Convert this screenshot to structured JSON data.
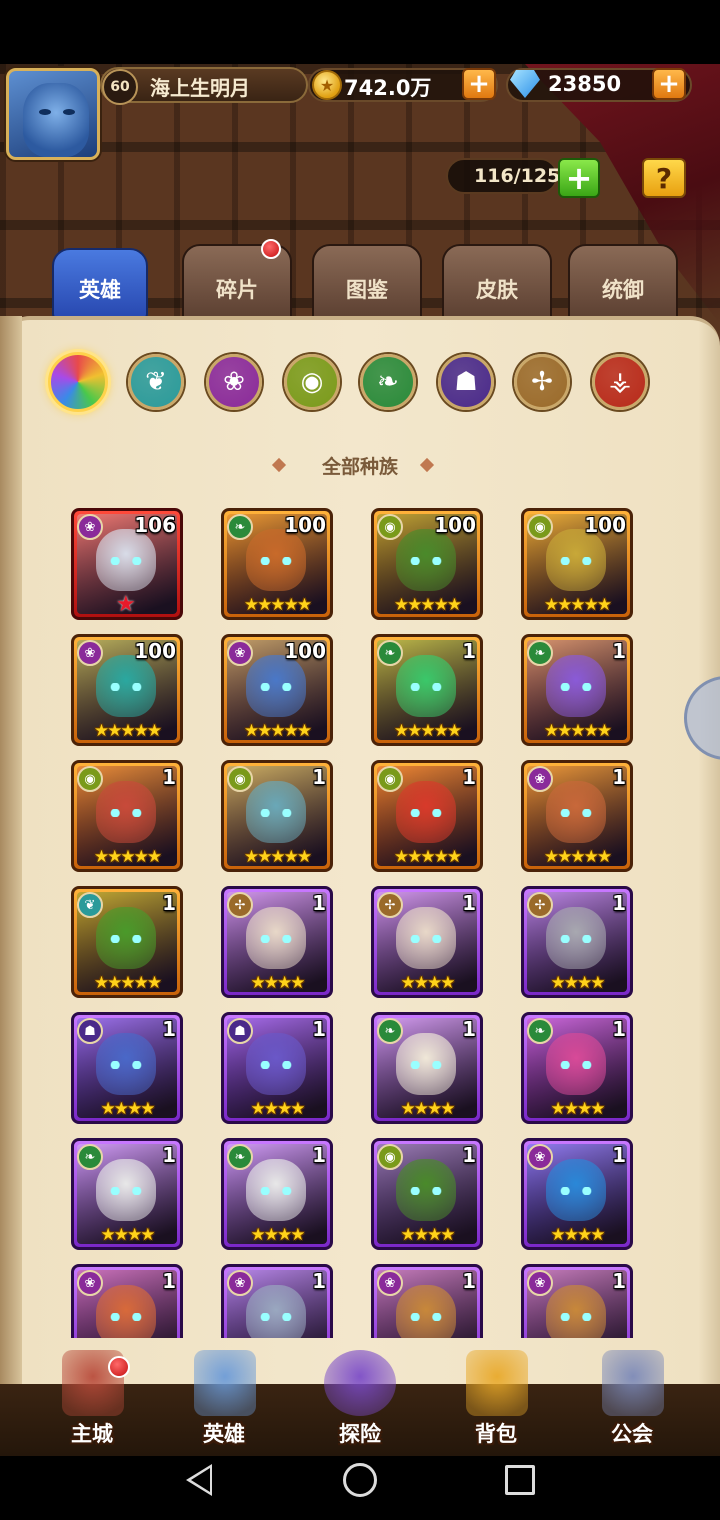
{
  "player": {
    "level": "60",
    "name": "海上生明月"
  },
  "resources": {
    "gold": "742.0万",
    "gems": "23850"
  },
  "capacity": "116/125",
  "help_label": "?",
  "tabs": [
    {
      "label": "英雄",
      "active": true
    },
    {
      "label": "碎片",
      "badge": true
    },
    {
      "label": "图鉴"
    },
    {
      "label": "皮肤"
    },
    {
      "label": "统御"
    }
  ],
  "race_filter": {
    "label": "全部种族",
    "icons": [
      {
        "name": "all-races",
        "color": "#e84a4a",
        "selected": true
      },
      {
        "name": "elf",
        "color": "#2a9a9a"
      },
      {
        "name": "mystic",
        "color": "#8a2a9a"
      },
      {
        "name": "orc",
        "color": "#7a9a1a"
      },
      {
        "name": "nature",
        "color": "#2a8a3a"
      },
      {
        "name": "undead",
        "color": "#4a2a8a"
      },
      {
        "name": "holy",
        "color": "#9a6a2a"
      },
      {
        "name": "demon",
        "color": "#b82a1a"
      }
    ]
  },
  "heroes": [
    {
      "level": "106",
      "stars": "",
      "red_star": true,
      "frame": "red",
      "race": "mystic",
      "skin": "#d8dce8"
    },
    {
      "level": "100",
      "stars": "★★★★★",
      "frame": "orange",
      "race": "nature",
      "skin": "#c86a2a"
    },
    {
      "level": "100",
      "stars": "★★★★★",
      "frame": "orange",
      "race": "orc",
      "skin": "#4a8a2a"
    },
    {
      "level": "100",
      "stars": "★★★★★",
      "frame": "orange",
      "race": "orc",
      "skin": "#c8a838"
    },
    {
      "level": "100",
      "stars": "★★★★★",
      "frame": "orange",
      "race": "mystic",
      "skin": "#2aa8a0"
    },
    {
      "level": "100",
      "stars": "★★★★★",
      "frame": "orange",
      "race": "mystic",
      "skin": "#4a78c8"
    },
    {
      "level": "1",
      "stars": "★★★★★",
      "frame": "orange",
      "race": "nature",
      "skin": "#3ac86a"
    },
    {
      "level": "1",
      "stars": "★★★★★",
      "frame": "orange",
      "race": "nature",
      "skin": "#8a5ad8"
    },
    {
      "level": "1",
      "stars": "★★★★★",
      "frame": "orange",
      "race": "orc",
      "skin": "#c84a3a"
    },
    {
      "level": "1",
      "stars": "★★★★★",
      "frame": "orange",
      "race": "orc",
      "skin": "#6aa8b8"
    },
    {
      "level": "1",
      "stars": "★★★★★",
      "frame": "orange",
      "race": "orc",
      "skin": "#d83a2a"
    },
    {
      "level": "1",
      "stars": "★★★★★",
      "frame": "orange",
      "race": "mystic",
      "skin": "#c8683a"
    },
    {
      "level": "1",
      "stars": "★★★★★",
      "frame": "orange",
      "race": "elf",
      "skin": "#4a9a2a"
    },
    {
      "level": "1",
      "stars": "★★★★",
      "frame": "purple",
      "race": "holy",
      "skin": "#e8d8c8"
    },
    {
      "level": "1",
      "stars": "★★★★",
      "frame": "purple",
      "race": "holy",
      "skin": "#e8d8c8"
    },
    {
      "level": "1",
      "stars": "★★★★",
      "frame": "purple",
      "race": "holy",
      "skin": "#a8a8b0"
    },
    {
      "level": "1",
      "stars": "★★★★",
      "frame": "purple",
      "race": "undead",
      "skin": "#4a68c8"
    },
    {
      "level": "1",
      "stars": "★★★★",
      "frame": "purple",
      "race": "undead",
      "skin": "#6a58c8"
    },
    {
      "level": "1",
      "stars": "★★★★",
      "frame": "purple",
      "race": "nature",
      "skin": "#f0e8d8"
    },
    {
      "level": "1",
      "stars": "★★★★",
      "frame": "purple",
      "race": "nature",
      "skin": "#d84a98"
    },
    {
      "level": "1",
      "stars": "★★★★",
      "frame": "purple",
      "race": "nature",
      "skin": "#e8e8e8"
    },
    {
      "level": "1",
      "stars": "★★★★",
      "frame": "purple",
      "race": "nature",
      "skin": "#e8e8e8"
    },
    {
      "level": "1",
      "stars": "★★★★",
      "frame": "purple",
      "race": "orc",
      "skin": "#4a8a2a"
    },
    {
      "level": "1",
      "stars": "★★★★",
      "frame": "purple",
      "race": "mystic",
      "skin": "#2a88d8"
    },
    {
      "level": "1",
      "stars": "",
      "frame": "purple",
      "race": "mystic",
      "skin": "#d86a3a"
    },
    {
      "level": "1",
      "stars": "",
      "frame": "purple",
      "race": "mystic",
      "skin": "#9aa8c0"
    },
    {
      "level": "1",
      "stars": "",
      "frame": "purple",
      "race": "mystic",
      "skin": "#c8883a"
    },
    {
      "level": "1",
      "stars": "",
      "frame": "purple",
      "race": "mystic",
      "skin": "#c8883a"
    }
  ],
  "bottom_nav": [
    {
      "label": "主城",
      "icon": "castle-icon",
      "color": "#b84a3a",
      "badge": true
    },
    {
      "label": "英雄",
      "icon": "hero-icon",
      "color": "#6a9ad8"
    },
    {
      "label": "探险",
      "icon": "portal-icon",
      "color": "#7a4ac8"
    },
    {
      "label": "背包",
      "icon": "bag-icon",
      "color": "#e8a828"
    },
    {
      "label": "公会",
      "icon": "guild-icon",
      "color": "#7a88b8"
    }
  ],
  "colors": {
    "accent_blue": "#2848b0",
    "gold": "#ffd21a",
    "panel": "#f3e7cc"
  }
}
